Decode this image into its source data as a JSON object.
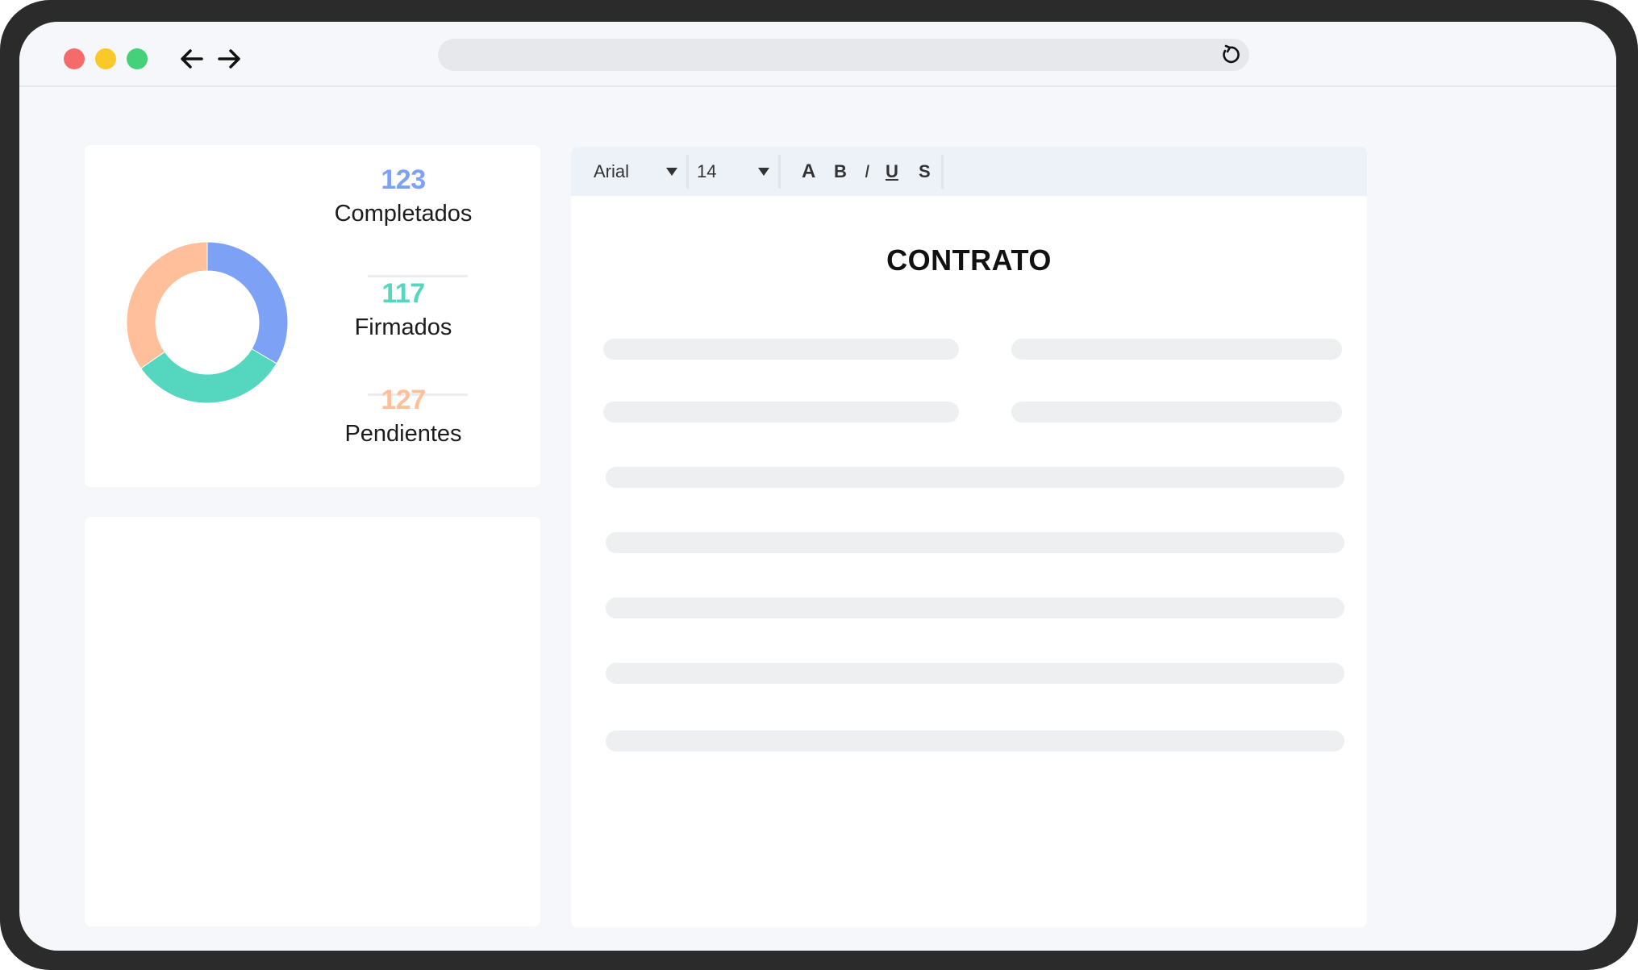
{
  "browser": {
    "window_controls": [
      "close",
      "minimize",
      "maximize"
    ],
    "address": ""
  },
  "stats": {
    "completed": {
      "value": "123",
      "label": "Completados",
      "color": "#7da2f5"
    },
    "signed": {
      "value": "117",
      "label": "Firmados",
      "color": "#55d6be"
    },
    "pending": {
      "value": "127",
      "label": "Pendientes",
      "color": "#ffbf9b"
    }
  },
  "editor": {
    "font": "Arial",
    "font_size": "14",
    "format_buttons": {
      "font_color": "A",
      "bold": "B",
      "italic": "I",
      "underline": "U",
      "strike": "S"
    }
  },
  "document": {
    "title": "CONTRATO"
  },
  "icons": [
    "back-arrow-icon",
    "forward-arrow-icon",
    "reload-icon",
    "dropdown-caret-icon"
  ]
}
